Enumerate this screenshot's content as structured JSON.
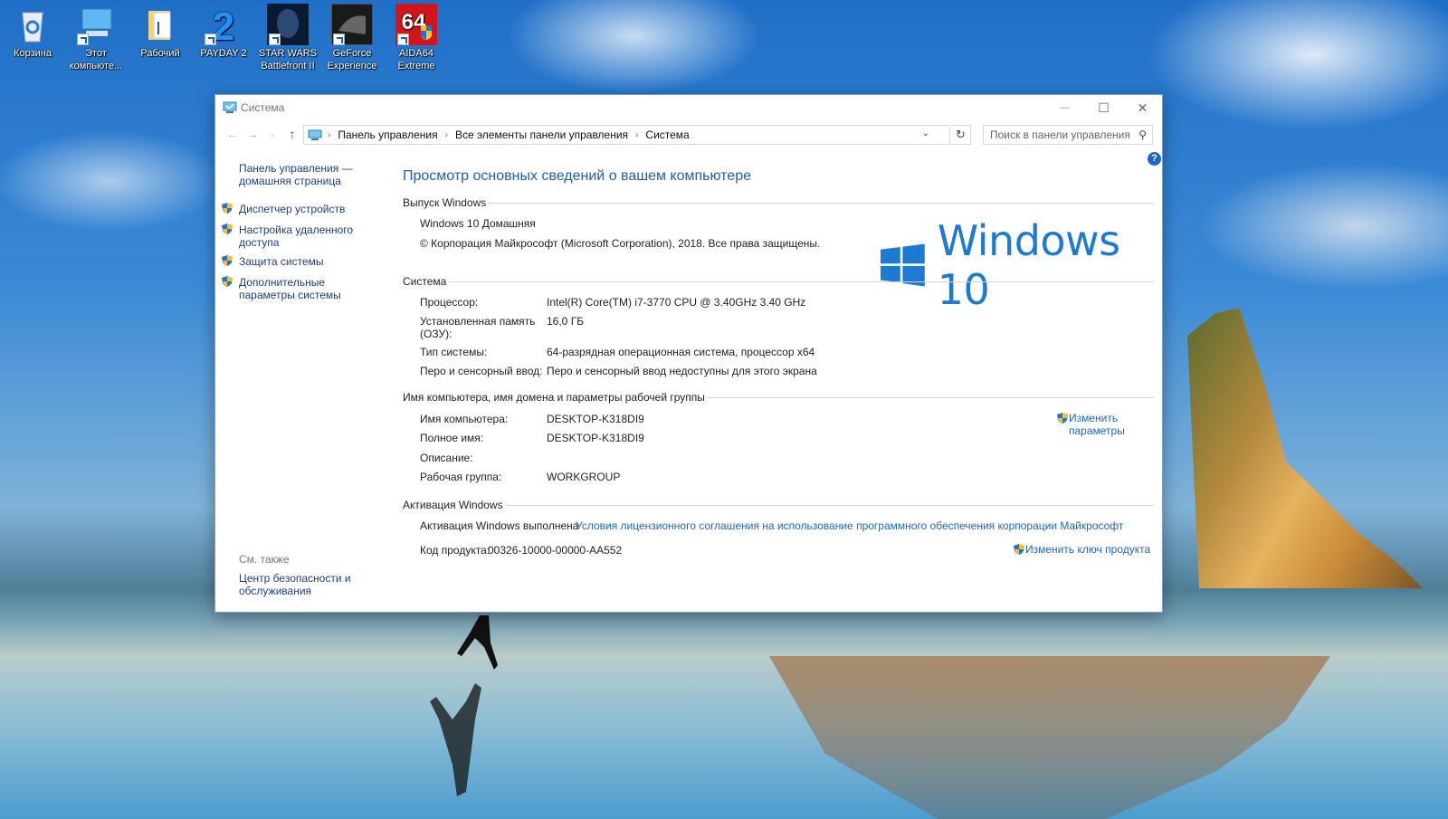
{
  "desktop": {
    "icons": [
      {
        "label": "Корзина",
        "icon": "recycle-bin-icon"
      },
      {
        "label": "Этот компьюте...",
        "icon": "this-pc-icon"
      },
      {
        "label": "Рабочий",
        "icon": "folder-icon"
      },
      {
        "label": "PAYDAY 2",
        "icon": "payday2-icon"
      },
      {
        "label": "STAR WARS Battlefront II",
        "icon": "battlefront-icon"
      },
      {
        "label": "GeForce Experience",
        "icon": "geforce-icon"
      },
      {
        "label": "AIDA64 Extreme",
        "icon": "aida64-icon"
      }
    ]
  },
  "window": {
    "title": "Система",
    "controls": {
      "minimize": "—",
      "maximize": "☐",
      "close": "✕"
    },
    "breadcrumb": [
      "Панель управления",
      "Все элементы панели управления",
      "Система"
    ],
    "search_placeholder": "Поиск в панели управления",
    "help": "?"
  },
  "sidebar": {
    "home_link": "Панель управления — домашняя страница",
    "items": [
      {
        "label": "Диспетчер устройств"
      },
      {
        "label": "Настройка удаленного доступа"
      },
      {
        "label": "Защита системы"
      },
      {
        "label": "Дополнительные параметры системы"
      }
    ],
    "see_also_label": "См. также",
    "see_also": [
      {
        "label": "Центр безопасности и обслуживания"
      }
    ]
  },
  "main": {
    "title": "Просмотр основных сведений о вашем компьютере",
    "edition": {
      "heading": "Выпуск Windows",
      "name": "Windows 10 Домашняя",
      "copyright": "© Корпорация Майкрософт (Microsoft Corporation), 2018. Все права защищены.",
      "logo_text": "Windows 10"
    },
    "system": {
      "heading": "Система",
      "rows": [
        {
          "label": "Процессор:",
          "value": "Intel(R) Core(TM) i7-3770 CPU @ 3.40GHz   3.40 GHz"
        },
        {
          "label": "Установленная память (ОЗУ):",
          "value": "16,0 ГБ"
        },
        {
          "label": "Тип системы:",
          "value": "64-разрядная операционная система, процессор x64"
        },
        {
          "label": "Перо и сенсорный ввод:",
          "value": "Перо и сенсорный ввод недоступны для этого экрана"
        }
      ]
    },
    "computer": {
      "heading": "Имя компьютера, имя домена и параметры рабочей группы",
      "rows": [
        {
          "label": "Имя компьютера:",
          "value": "DESKTOP-K318DI9"
        },
        {
          "label": "Полное имя:",
          "value": "DESKTOP-K318DI9"
        },
        {
          "label": "Описание:",
          "value": ""
        },
        {
          "label": "Рабочая группа:",
          "value": "WORKGROUP"
        }
      ],
      "change_link": "Изменить параметры"
    },
    "activation": {
      "heading": "Активация Windows",
      "status": "Активация Windows выполнена",
      "license_link": "Условия лицензионного соглашения на использование программного обеспечения корпорации Майкрософт",
      "product_key_label": "Код продукта:",
      "product_key": "00326-10000-00000-AA552",
      "change_key_link": "Изменить ключ продукта"
    }
  },
  "colors": {
    "accent": "#1e66c4",
    "sidebar_link": "#1c3e8b",
    "logo": "#1c7ad2"
  }
}
